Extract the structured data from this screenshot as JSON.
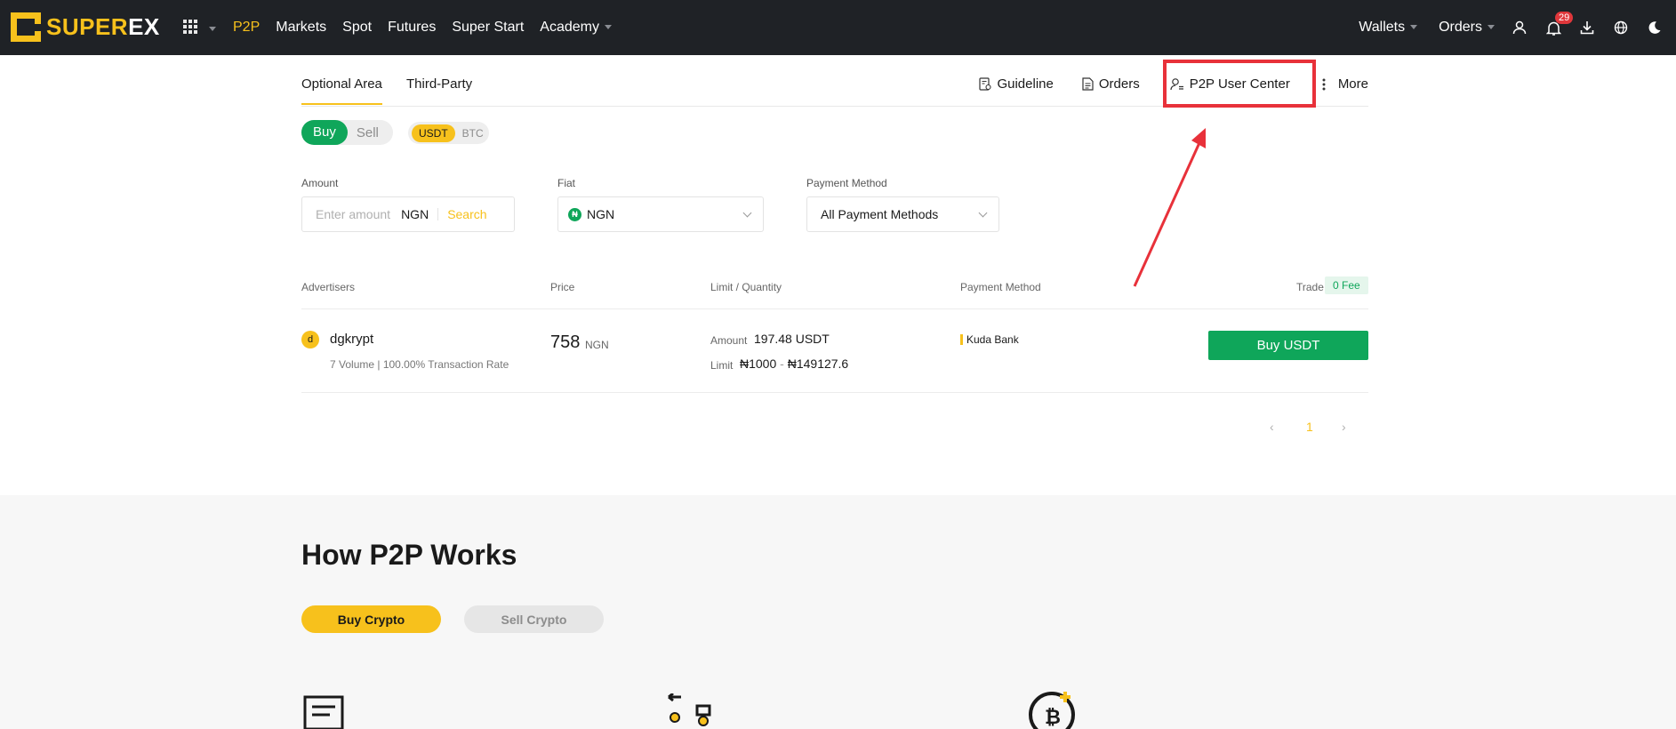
{
  "brand": {
    "super": "SUPER",
    "ex": "EX"
  },
  "nav": {
    "items": [
      {
        "label": "P2P",
        "active": true
      },
      {
        "label": "Markets"
      },
      {
        "label": "Spot"
      },
      {
        "label": "Futures"
      },
      {
        "label": "Super Start"
      },
      {
        "label": "Academy"
      }
    ],
    "wallets": "Wallets",
    "orders": "Orders",
    "notifications_count": "29"
  },
  "tabs": {
    "optional": "Optional Area",
    "third_party": "Third-Party"
  },
  "links": {
    "guideline": "Guideline",
    "orders": "Orders",
    "user_center": "P2P User Center",
    "more": "More"
  },
  "trade_toggle": {
    "buy": "Buy",
    "sell": "Sell"
  },
  "asset_toggle": {
    "usdt": "USDT",
    "btc": "BTC"
  },
  "filters": {
    "amount_label": "Amount",
    "amount_placeholder": "Enter amount",
    "amount_currency": "NGN",
    "search": "Search",
    "fiat_label": "Fiat",
    "fiat_value": "NGN",
    "fiat_symbol": "₦",
    "payment_label": "Payment Method",
    "payment_value": "All Payment Methods"
  },
  "table": {
    "headers": {
      "advertisers": "Advertisers",
      "price": "Price",
      "limit": "Limit / Quantity",
      "payment": "Payment Method",
      "trade": "Trade",
      "fee": "0 Fee"
    },
    "rows": [
      {
        "avatar": "d",
        "name": "dgkrypt",
        "stats": "7 Volume | 100.00% Transaction Rate",
        "price": "758",
        "price_unit": "NGN",
        "amount_label": "Amount",
        "amount": "197.48 USDT",
        "limit_label": "Limit",
        "limit_min": "₦1000",
        "limit_sep": "-",
        "limit_max": "₦149127.6",
        "payment": "Kuda Bank",
        "action": "Buy USDT"
      }
    ]
  },
  "pagination": {
    "current": "1"
  },
  "how": {
    "title": "How P2P Works",
    "buy": "Buy Crypto",
    "sell": "Sell Crypto"
  },
  "colors": {
    "accent": "#f7c11c",
    "buy": "#0fa65a",
    "highlight": "#e8313a"
  }
}
